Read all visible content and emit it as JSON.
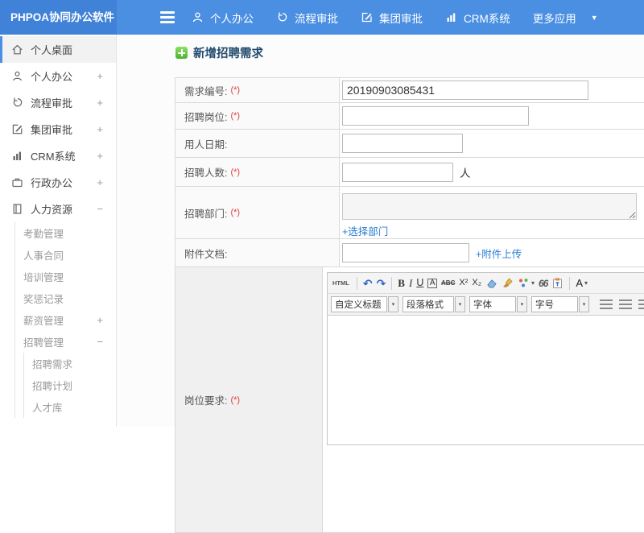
{
  "topbar": {
    "logo": "PHPOA协同办公软件",
    "nav": [
      {
        "label": "个人办公"
      },
      {
        "label": "流程审批"
      },
      {
        "label": "集团审批"
      },
      {
        "label": "CRM系统"
      },
      {
        "label": "更多应用"
      }
    ]
  },
  "icons": {
    "caret_down": "▼",
    "dropdown_arrow": "▾"
  },
  "sidebar": {
    "items": [
      {
        "label": "个人桌面",
        "expand": ""
      },
      {
        "label": "个人办公",
        "expand": "+"
      },
      {
        "label": "流程审批",
        "expand": "+"
      },
      {
        "label": "集团审批",
        "expand": "+"
      },
      {
        "label": "CRM系统",
        "expand": "+"
      },
      {
        "label": "行政办公",
        "expand": "+"
      },
      {
        "label": "人力资源",
        "expand": "−"
      }
    ],
    "hr_items": [
      {
        "label": "考勤管理",
        "expand": ""
      },
      {
        "label": "人事合同",
        "expand": ""
      },
      {
        "label": "培训管理",
        "expand": ""
      },
      {
        "label": "奖惩记录",
        "expand": ""
      },
      {
        "label": "薪资管理",
        "expand": "+"
      },
      {
        "label": "招聘管理",
        "expand": "−"
      }
    ],
    "recruit_items": [
      {
        "label": "招聘需求"
      },
      {
        "label": "招聘计划"
      },
      {
        "label": "人才库"
      }
    ]
  },
  "main": {
    "title": "新增招聘需求",
    "form": {
      "rows": [
        {
          "label": "需求编号:",
          "required": "(*)",
          "value": "20190903085431"
        },
        {
          "label": "招聘岗位:",
          "required": "(*)",
          "value": ""
        },
        {
          "label": "用人日期:",
          "required": "",
          "value": ""
        },
        {
          "label": "招聘人数:",
          "required": "(*)",
          "value": "",
          "suffix": "人"
        },
        {
          "label": "招聘部门:",
          "required": "(*)",
          "link": "+选择部门"
        },
        {
          "label": "附件文档:",
          "required": "",
          "value": "",
          "link": "+附件上传"
        },
        {
          "label": "岗位要求:",
          "required": "(*)"
        }
      ]
    },
    "editor": {
      "html_btn": "HTML",
      "undo": "↶",
      "redo": "↷",
      "bold": "B",
      "italic": "I",
      "underline": "U",
      "font_box": "A",
      "strike": "ABC",
      "superscript": "X²",
      "subscript": "X₂",
      "quote": "66",
      "font_color": "A",
      "dropdowns": [
        {
          "label": "自定义标题"
        },
        {
          "label": "段落格式"
        },
        {
          "label": "字体"
        },
        {
          "label": "字号"
        }
      ]
    }
  }
}
